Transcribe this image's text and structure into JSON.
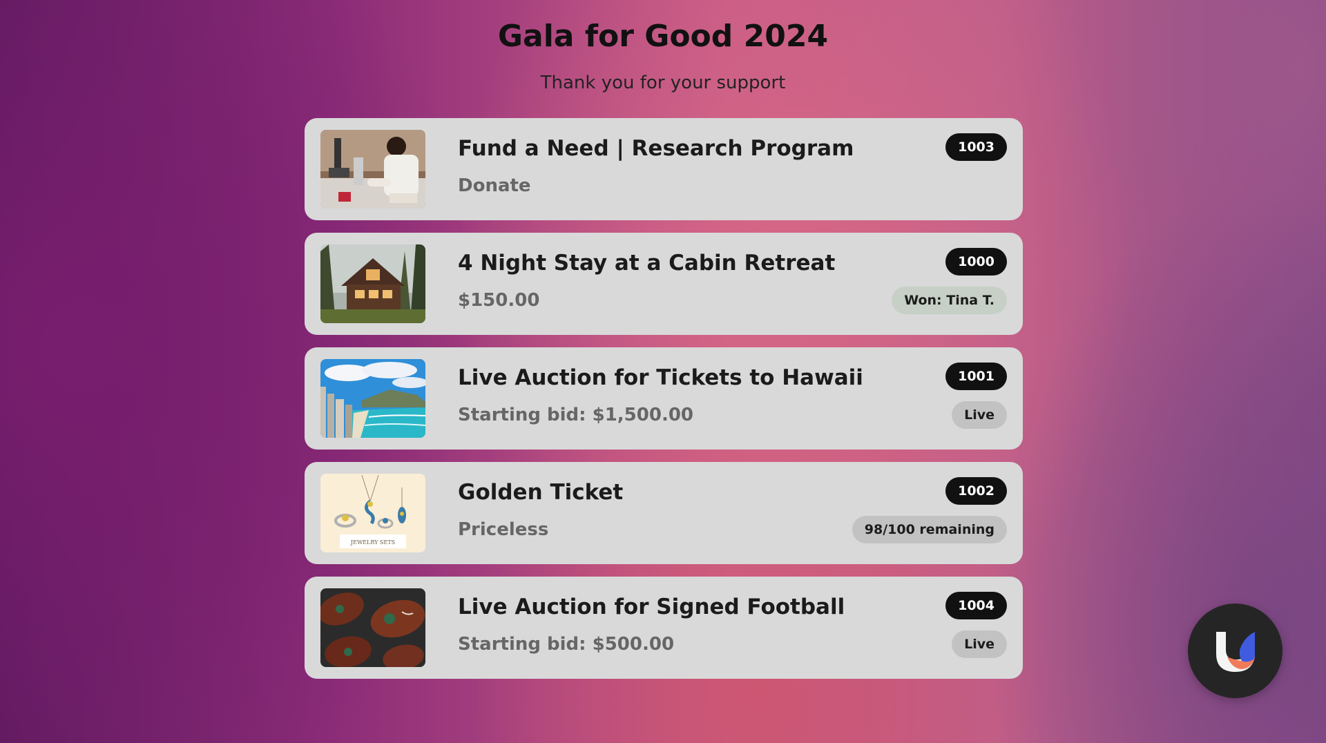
{
  "header": {
    "title": "Gala for Good 2024",
    "subtitle": "Thank you for your support"
  },
  "items": [
    {
      "title": "Fund a Need | Research Program",
      "subtitle": "Donate",
      "lot": "1003",
      "status": "",
      "image": "lab-researcher-microscope"
    },
    {
      "title": "4 Night Stay at a Cabin Retreat",
      "subtitle": "$150.00",
      "lot": "1000",
      "status": "Won: Tina T.",
      "image": "forest-cabin"
    },
    {
      "title": "Live Auction for Tickets to Hawaii",
      "subtitle": "Starting bid: $1,500.00",
      "lot": "1001",
      "status": "Live",
      "image": "hawaii-beach"
    },
    {
      "title": "Golden Ticket",
      "subtitle": "Priceless",
      "lot": "1002",
      "status": "98/100 remaining",
      "image": "jewelry-sets",
      "image_caption": "JEWELRY SETS"
    },
    {
      "title": "Live Auction for Signed Football",
      "subtitle": "Starting bid: $500.00",
      "lot": "1004",
      "status": "Live",
      "image": "footballs"
    }
  ],
  "fab": {
    "icon": "u-logo-icon"
  },
  "colors": {
    "card_bg": "#d9d9d9",
    "lot_badge_bg": "#111111",
    "won_badge_bg": "#c6d0c6",
    "live_badge_bg": "#c2c2c2",
    "logo_blue": "#3f5be0",
    "logo_orange": "#f07a5a"
  }
}
